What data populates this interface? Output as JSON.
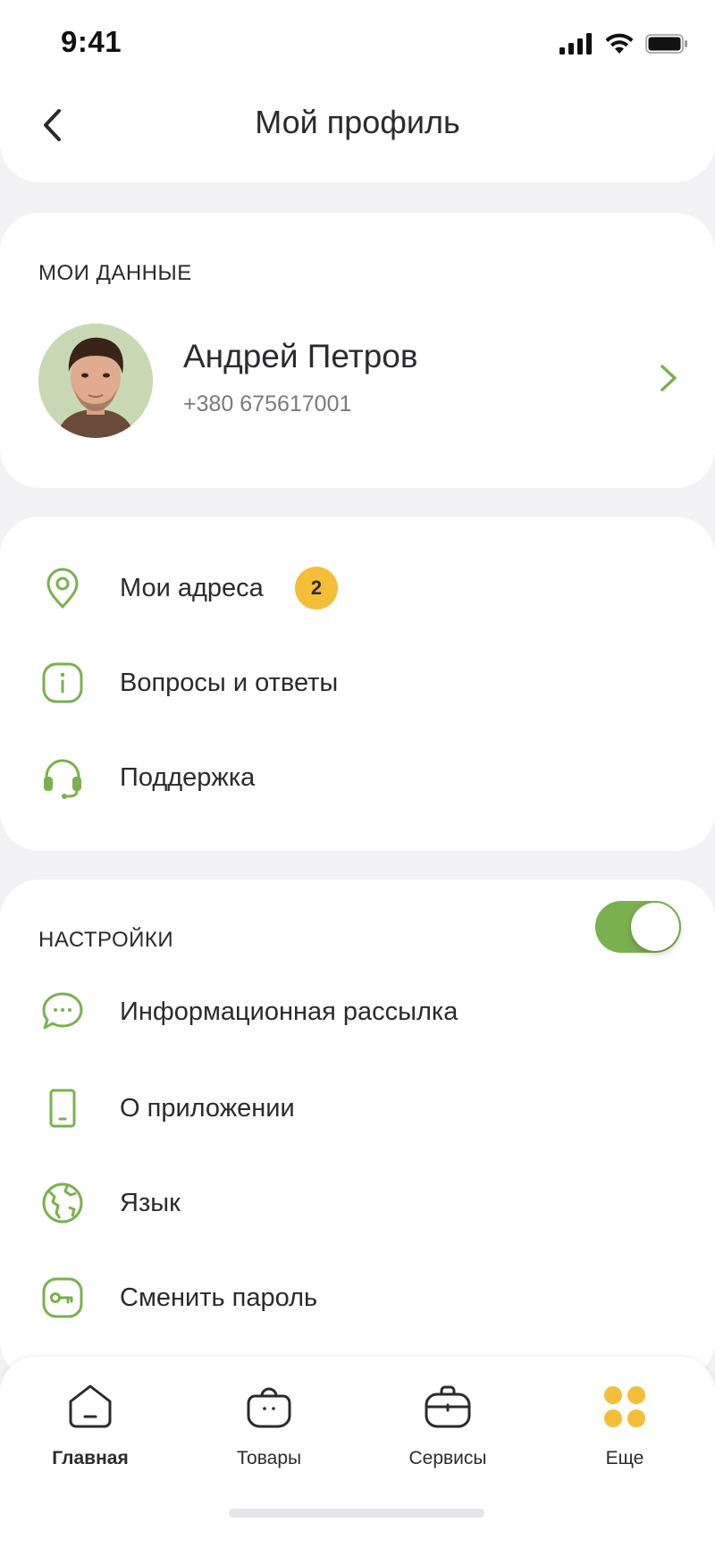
{
  "status_bar": {
    "time": "9:41"
  },
  "header": {
    "title": "Мой профиль"
  },
  "profile_section": {
    "title": "МОИ ДАННЫЕ",
    "name": "Андрей Петров",
    "phone": "+380 675617001"
  },
  "menu": {
    "items": [
      {
        "label": "Мои адреса",
        "icon": "location-pin-icon",
        "badge": "2"
      },
      {
        "label": "Вопросы и ответы",
        "icon": "info-icon"
      },
      {
        "label": "Поддержка",
        "icon": "headset-icon"
      }
    ]
  },
  "settings": {
    "title": "НАСТРОЙКИ",
    "toggle_on": true,
    "items": [
      {
        "label": "Информационная рассылка",
        "icon": "chat-bubble-icon"
      },
      {
        "label": "О приложении",
        "icon": "phone-device-icon"
      },
      {
        "label": "Язык",
        "icon": "globe-icon"
      },
      {
        "label": "Сменить пароль",
        "icon": "key-icon"
      }
    ]
  },
  "bottom_nav": {
    "items": [
      {
        "label": "Главная",
        "icon": "home-icon",
        "active": true
      },
      {
        "label": "Товары",
        "icon": "shopping-bag-icon"
      },
      {
        "label": "Сервисы",
        "icon": "briefcase-icon"
      },
      {
        "label": "Еще",
        "icon": "more-dots-icon"
      }
    ]
  },
  "colors": {
    "accent_green": "#7bb04e",
    "badge_yellow": "#f4be38",
    "background": "#f2f2f4",
    "text": "#2b2b2e"
  }
}
